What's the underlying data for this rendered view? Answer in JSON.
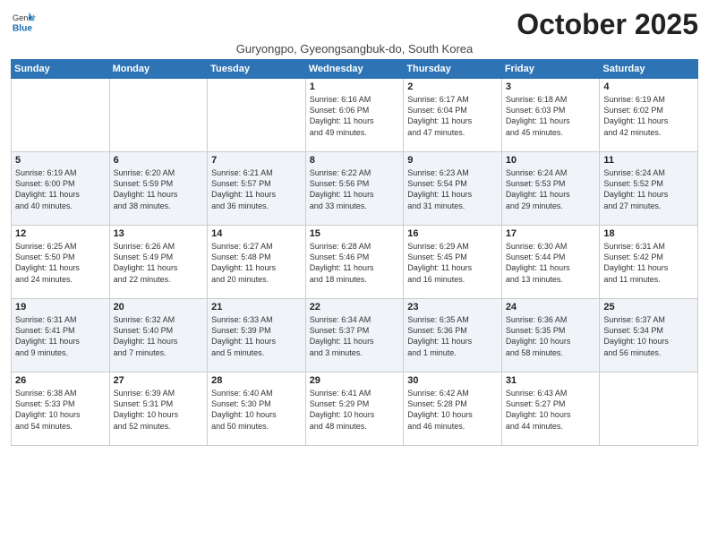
{
  "header": {
    "logo_general": "General",
    "logo_blue": "Blue",
    "month_title": "October 2025",
    "subtitle": "Guryongpo, Gyeongsangbuk-do, South Korea"
  },
  "weekdays": [
    "Sunday",
    "Monday",
    "Tuesday",
    "Wednesday",
    "Thursday",
    "Friday",
    "Saturday"
  ],
  "weeks": [
    [
      {
        "day": "",
        "info": ""
      },
      {
        "day": "",
        "info": ""
      },
      {
        "day": "",
        "info": ""
      },
      {
        "day": "1",
        "info": "Sunrise: 6:16 AM\nSunset: 6:06 PM\nDaylight: 11 hours\nand 49 minutes."
      },
      {
        "day": "2",
        "info": "Sunrise: 6:17 AM\nSunset: 6:04 PM\nDaylight: 11 hours\nand 47 minutes."
      },
      {
        "day": "3",
        "info": "Sunrise: 6:18 AM\nSunset: 6:03 PM\nDaylight: 11 hours\nand 45 minutes."
      },
      {
        "day": "4",
        "info": "Sunrise: 6:19 AM\nSunset: 6:02 PM\nDaylight: 11 hours\nand 42 minutes."
      }
    ],
    [
      {
        "day": "5",
        "info": "Sunrise: 6:19 AM\nSunset: 6:00 PM\nDaylight: 11 hours\nand 40 minutes."
      },
      {
        "day": "6",
        "info": "Sunrise: 6:20 AM\nSunset: 5:59 PM\nDaylight: 11 hours\nand 38 minutes."
      },
      {
        "day": "7",
        "info": "Sunrise: 6:21 AM\nSunset: 5:57 PM\nDaylight: 11 hours\nand 36 minutes."
      },
      {
        "day": "8",
        "info": "Sunrise: 6:22 AM\nSunset: 5:56 PM\nDaylight: 11 hours\nand 33 minutes."
      },
      {
        "day": "9",
        "info": "Sunrise: 6:23 AM\nSunset: 5:54 PM\nDaylight: 11 hours\nand 31 minutes."
      },
      {
        "day": "10",
        "info": "Sunrise: 6:24 AM\nSunset: 5:53 PM\nDaylight: 11 hours\nand 29 minutes."
      },
      {
        "day": "11",
        "info": "Sunrise: 6:24 AM\nSunset: 5:52 PM\nDaylight: 11 hours\nand 27 minutes."
      }
    ],
    [
      {
        "day": "12",
        "info": "Sunrise: 6:25 AM\nSunset: 5:50 PM\nDaylight: 11 hours\nand 24 minutes."
      },
      {
        "day": "13",
        "info": "Sunrise: 6:26 AM\nSunset: 5:49 PM\nDaylight: 11 hours\nand 22 minutes."
      },
      {
        "day": "14",
        "info": "Sunrise: 6:27 AM\nSunset: 5:48 PM\nDaylight: 11 hours\nand 20 minutes."
      },
      {
        "day": "15",
        "info": "Sunrise: 6:28 AM\nSunset: 5:46 PM\nDaylight: 11 hours\nand 18 minutes."
      },
      {
        "day": "16",
        "info": "Sunrise: 6:29 AM\nSunset: 5:45 PM\nDaylight: 11 hours\nand 16 minutes."
      },
      {
        "day": "17",
        "info": "Sunrise: 6:30 AM\nSunset: 5:44 PM\nDaylight: 11 hours\nand 13 minutes."
      },
      {
        "day": "18",
        "info": "Sunrise: 6:31 AM\nSunset: 5:42 PM\nDaylight: 11 hours\nand 11 minutes."
      }
    ],
    [
      {
        "day": "19",
        "info": "Sunrise: 6:31 AM\nSunset: 5:41 PM\nDaylight: 11 hours\nand 9 minutes."
      },
      {
        "day": "20",
        "info": "Sunrise: 6:32 AM\nSunset: 5:40 PM\nDaylight: 11 hours\nand 7 minutes."
      },
      {
        "day": "21",
        "info": "Sunrise: 6:33 AM\nSunset: 5:39 PM\nDaylight: 11 hours\nand 5 minutes."
      },
      {
        "day": "22",
        "info": "Sunrise: 6:34 AM\nSunset: 5:37 PM\nDaylight: 11 hours\nand 3 minutes."
      },
      {
        "day": "23",
        "info": "Sunrise: 6:35 AM\nSunset: 5:36 PM\nDaylight: 11 hours\nand 1 minute."
      },
      {
        "day": "24",
        "info": "Sunrise: 6:36 AM\nSunset: 5:35 PM\nDaylight: 10 hours\nand 58 minutes."
      },
      {
        "day": "25",
        "info": "Sunrise: 6:37 AM\nSunset: 5:34 PM\nDaylight: 10 hours\nand 56 minutes."
      }
    ],
    [
      {
        "day": "26",
        "info": "Sunrise: 6:38 AM\nSunset: 5:33 PM\nDaylight: 10 hours\nand 54 minutes."
      },
      {
        "day": "27",
        "info": "Sunrise: 6:39 AM\nSunset: 5:31 PM\nDaylight: 10 hours\nand 52 minutes."
      },
      {
        "day": "28",
        "info": "Sunrise: 6:40 AM\nSunset: 5:30 PM\nDaylight: 10 hours\nand 50 minutes."
      },
      {
        "day": "29",
        "info": "Sunrise: 6:41 AM\nSunset: 5:29 PM\nDaylight: 10 hours\nand 48 minutes."
      },
      {
        "day": "30",
        "info": "Sunrise: 6:42 AM\nSunset: 5:28 PM\nDaylight: 10 hours\nand 46 minutes."
      },
      {
        "day": "31",
        "info": "Sunrise: 6:43 AM\nSunset: 5:27 PM\nDaylight: 10 hours\nand 44 minutes."
      },
      {
        "day": "",
        "info": ""
      }
    ]
  ]
}
